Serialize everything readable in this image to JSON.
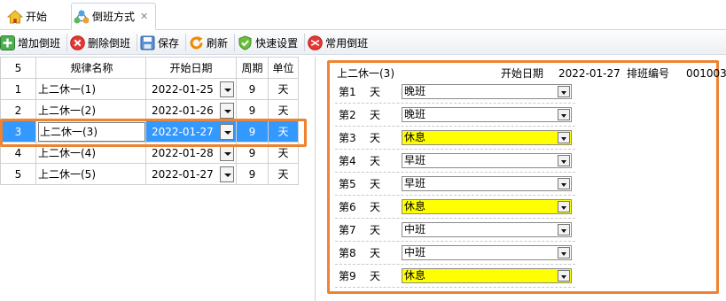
{
  "tabs": [
    {
      "label": "开始",
      "icon": "home-icon"
    },
    {
      "label": "倒班方式",
      "icon": "shift-icon",
      "close": "✕"
    }
  ],
  "toolbar": {
    "add": "增加倒班",
    "delete": "删除倒班",
    "save": "保存",
    "refresh": "刷新",
    "quick": "快速设置",
    "common": "常用倒班"
  },
  "grid": {
    "count": "5",
    "headers": {
      "name": "规律名称",
      "date": "开始日期",
      "cycle": "周期",
      "unit": "单位"
    },
    "rows": [
      {
        "no": "1",
        "name": "上二休一(1)",
        "date": "2022-01-25",
        "cycle": "9",
        "unit": "天"
      },
      {
        "no": "2",
        "name": "上二休一(2)",
        "date": "2022-01-26",
        "cycle": "9",
        "unit": "天"
      },
      {
        "no": "3",
        "name": "上二休一(3)",
        "date": "2022-01-27",
        "cycle": "9",
        "unit": "天"
      },
      {
        "no": "4",
        "name": "上二休一(4)",
        "date": "2022-01-28",
        "cycle": "9",
        "unit": "天"
      },
      {
        "no": "5",
        "name": "上二休一(5)",
        "date": "2022-01-27",
        "cycle": "9",
        "unit": "天"
      }
    ]
  },
  "detail": {
    "title": "上二休一(3)",
    "start_label": "开始日期",
    "start_date": "2022-01-27",
    "code_label": "排班编号",
    "code": "001003",
    "unit": "天",
    "days": [
      {
        "label": "第1",
        "shift": "晚班",
        "rest": false
      },
      {
        "label": "第2",
        "shift": "晚班",
        "rest": false
      },
      {
        "label": "第3",
        "shift": "休息",
        "rest": true
      },
      {
        "label": "第4",
        "shift": "早班",
        "rest": false
      },
      {
        "label": "第5",
        "shift": "早班",
        "rest": false
      },
      {
        "label": "第6",
        "shift": "休息",
        "rest": true
      },
      {
        "label": "第7",
        "shift": "中班",
        "rest": false
      },
      {
        "label": "第8",
        "shift": "中班",
        "rest": false
      },
      {
        "label": "第9",
        "shift": "休息",
        "rest": true
      }
    ]
  },
  "colors": {
    "accent": "#ee8432",
    "selection": "#3399ff",
    "rest": "#ffff00"
  }
}
